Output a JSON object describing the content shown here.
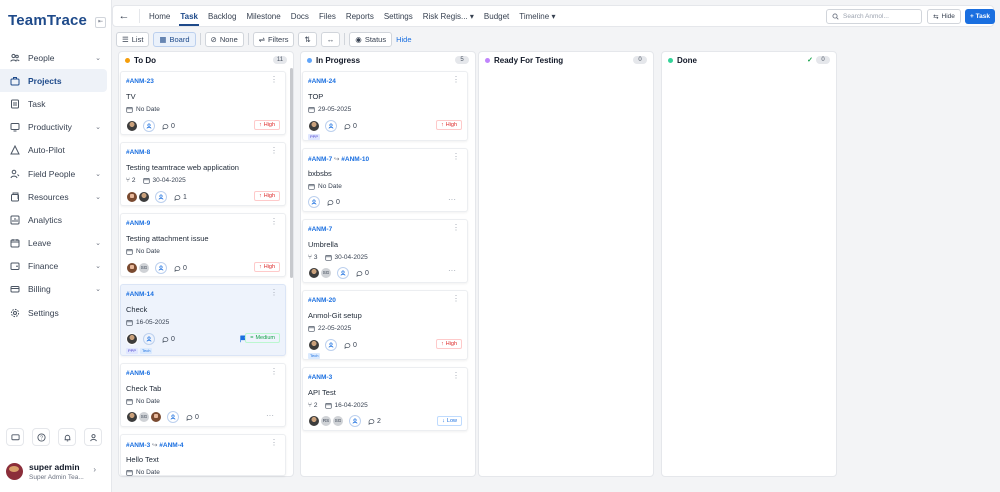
{
  "app": {
    "logo": "TeamTrace",
    "toggle_icon": "sidebar-toggle-icon"
  },
  "sidebar": {
    "items": [
      {
        "label": "People",
        "icon": "people-icon",
        "chevron": true
      },
      {
        "label": "Projects",
        "icon": "projects-icon",
        "active": true
      },
      {
        "label": "Task",
        "icon": "task-icon"
      },
      {
        "label": "Productivity",
        "icon": "productivity-icon",
        "chevron": true
      },
      {
        "label": "Auto-Pilot",
        "icon": "auto-pilot-icon"
      },
      {
        "label": "Field People",
        "icon": "field-people-icon",
        "chevron": true
      },
      {
        "label": "Resources",
        "icon": "resources-icon",
        "chevron": true
      },
      {
        "label": "Analytics",
        "icon": "analytics-icon"
      },
      {
        "label": "Leave",
        "icon": "leave-icon",
        "chevron": true
      },
      {
        "label": "Finance",
        "icon": "finance-icon",
        "chevron": true
      },
      {
        "label": "Billing",
        "icon": "billing-icon",
        "chevron": true
      },
      {
        "label": "Settings",
        "icon": "settings-icon"
      }
    ],
    "user": {
      "name": "super admin",
      "role": "Super Admin Tea..."
    }
  },
  "topbar": {
    "tabs": [
      "Home",
      "Task",
      "Backlog",
      "Milestone",
      "Docs",
      "Files",
      "Reports",
      "Settings",
      "Risk Regis...",
      "Budget",
      "Timeline"
    ],
    "active_tab": "Task",
    "search_placeholder": "Search Anmol...",
    "hide_label": "Hide",
    "add_label": "+ Task"
  },
  "toolbar": {
    "list_label": "List",
    "board_label": "Board",
    "none_label": "None",
    "filters_label": "Filters",
    "status_label": "Status",
    "hide_link": "Hide"
  },
  "columns": [
    {
      "name": "To Do",
      "count": "11",
      "color": "#f59e0b"
    },
    {
      "name": "In Progress",
      "count": "5",
      "color": "#60a5fa"
    },
    {
      "name": "Ready For Testing",
      "count": "0",
      "color": "#c084fc"
    },
    {
      "name": "Done",
      "count": "0",
      "color": "#34d399"
    }
  ],
  "cards": {
    "todo": [
      {
        "id": "#ANM-23",
        "title": "TV",
        "date": "No Date",
        "comments": "0",
        "priority": "High"
      },
      {
        "id": "#ANM-8",
        "title": "Testing teamtrace web application",
        "subtasks": "2",
        "date": "30-04-2025",
        "comments": "1",
        "priority": "High"
      },
      {
        "id": "#ANM-9",
        "title": "Testing attachment issue",
        "date": "No Date",
        "avatar_initials": "SG",
        "comments": "0",
        "priority": "High"
      },
      {
        "id": "#ANM-14",
        "title": "Check",
        "date": "16-05-2025",
        "comments": "0",
        "priority": "Medium",
        "tags": [
          "PPP",
          "Tech"
        ]
      },
      {
        "id": "#ANM-6",
        "title": "Check Tab",
        "date": "No Date",
        "avatar_initials": "SG",
        "comments": "0"
      },
      {
        "id_parent": "#ANM-3",
        "id": "#ANM-4",
        "title": "Hello Text",
        "date": "No Date"
      }
    ],
    "progress": [
      {
        "id": "#ANM-24",
        "title": "TOP",
        "date": "29-05-2025",
        "comments": "0",
        "priority": "High",
        "tags": [
          "PPP"
        ]
      },
      {
        "id_parent": "#ANM-7",
        "id": "#ANM-10",
        "title": "bxbsbs",
        "date": "No Date",
        "comments": "0"
      },
      {
        "id": "#ANM-7",
        "title": "Umbrella",
        "subtasks": "3",
        "date": "30-04-2025",
        "avatar_initials": "SG",
        "comments": "0"
      },
      {
        "id": "#ANM-20",
        "title": "Anmol-Git setup",
        "date": "22-05-2025",
        "comments": "0",
        "priority": "High",
        "tags": [
          "Tech"
        ]
      },
      {
        "id": "#ANM-3",
        "title": "API Test",
        "subtasks": "2",
        "date": "16-04-2025",
        "avatar_initials": [
          "RS",
          "SG"
        ],
        "comments": "2",
        "priority": "Low"
      }
    ]
  }
}
